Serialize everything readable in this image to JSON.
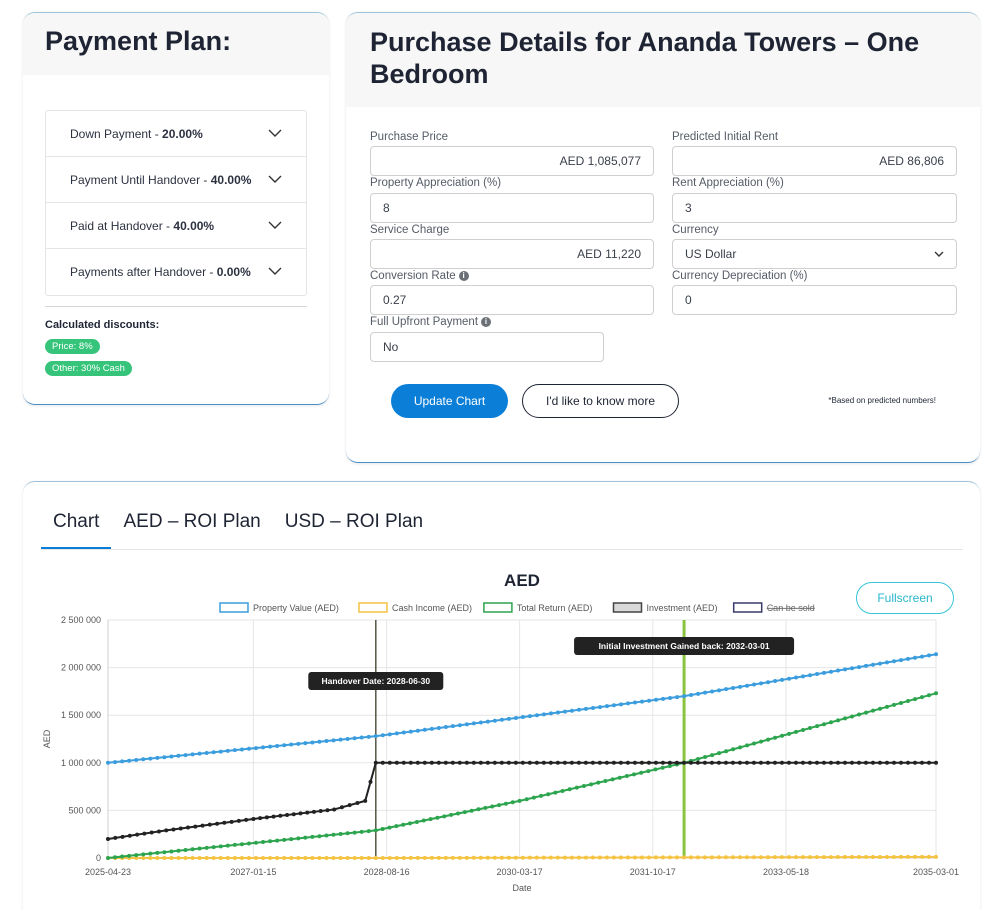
{
  "payment_plan": {
    "title": "Payment Plan:",
    "items": [
      {
        "label": "Down Payment - ",
        "value": "20.00%"
      },
      {
        "label": "Payment Until Handover - ",
        "value": "40.00%"
      },
      {
        "label": "Paid at Handover - ",
        "value": "40.00%"
      },
      {
        "label": "Payments after Handover - ",
        "value": "0.00%"
      }
    ],
    "discounts_label": "Calculated discounts:",
    "badges": [
      "Price: 8%",
      "Other: 30% Cash"
    ]
  },
  "purchase": {
    "title": "Purchase Details for Ananda Towers – One Bedroom",
    "fields": {
      "purchase_price": {
        "label": "Purchase Price",
        "value": "AED 1,085,077"
      },
      "initial_rent": {
        "label": "Predicted Initial Rent",
        "value": "AED 86,806"
      },
      "property_appreciation": {
        "label": "Property Appreciation (%)",
        "value": "8"
      },
      "rent_appreciation": {
        "label": "Rent Appreciation (%)",
        "value": "3"
      },
      "service_charge": {
        "label": "Service Charge",
        "value": "AED 11,220"
      },
      "currency": {
        "label": "Currency",
        "value": "US Dollar"
      },
      "conversion_rate": {
        "label": "Conversion Rate",
        "value": "0.27"
      },
      "currency_depreciation": {
        "label": "Currency Depreciation (%)",
        "value": "0"
      },
      "full_upfront": {
        "label": "Full Upfront Payment",
        "value": "No"
      }
    },
    "update_button": "Update Chart",
    "more_button": "I'd like to know more",
    "note": "*Based on predicted numbers!"
  },
  "chart_section": {
    "tabs": [
      "Chart",
      "AED – ROI Plan",
      "USD – ROI Plan"
    ],
    "active_tab": 0,
    "fullscreen_label": "Fullscreen"
  },
  "chart_data": {
    "type": "line",
    "title": "AED",
    "xlabel": "Date",
    "ylabel": "AED",
    "ylim": [
      0,
      2500000
    ],
    "y_ticks": [
      "0",
      "500 000",
      "1 000 000",
      "1 500 000",
      "2 000 000",
      "2 500 000"
    ],
    "y_tick_values": [
      0,
      500000,
      1000000,
      1500000,
      2000000,
      2500000
    ],
    "x_ticks": [
      "2025-04-23",
      "2027-01-15",
      "2028-08-16",
      "2030-03-17",
      "2031-10-17",
      "2033-05-18",
      "2035-03-01"
    ],
    "x_range": [
      "2025-04-23",
      "2035-03-01"
    ],
    "grid": true,
    "legend_position": "top",
    "legend": [
      {
        "name": "Property Value (AED)",
        "stroke": "#3b9ddd",
        "fill": "#ffffff"
      },
      {
        "name": "Cash Income (AED)",
        "stroke": "#f5c342",
        "fill": "#ffffff"
      },
      {
        "name": "Total Return (AED)",
        "stroke": "#2da44e",
        "fill": "#ffffff"
      },
      {
        "name": "Investment (AED)",
        "stroke": "#444444",
        "fill": "#d9d9d9"
      },
      {
        "name": "Can be sold",
        "stroke": "#3a3a6a",
        "fill": "#ffffff",
        "hidden": true
      }
    ],
    "series": [
      {
        "name": "Property Value (AED)",
        "color": "#3b9ddd",
        "x": [
          "2025-04-23",
          "2028-06-30",
          "2032-03-01",
          "2035-03-01"
        ],
        "y": [
          1000000,
          1280000,
          1700000,
          2140000
        ]
      },
      {
        "name": "Cash Income (AED)",
        "color": "#f5c342",
        "x": [
          "2025-04-23",
          "2028-06-30",
          "2035-03-01"
        ],
        "y": [
          0,
          0,
          12000
        ]
      },
      {
        "name": "Total Return (AED)",
        "color": "#2da44e",
        "x": [
          "2025-04-23",
          "2028-06-30",
          "2030-03-17",
          "2032-03-01",
          "2035-03-01"
        ],
        "y": [
          0,
          290000,
          600000,
          1000000,
          1730000
        ]
      },
      {
        "name": "Investment (AED)",
        "color": "#222222",
        "x": [
          "2025-04-23",
          "2026-01-01",
          "2027-01-15",
          "2028-01-01",
          "2028-05-15",
          "2028-06-30",
          "2035-03-01"
        ],
        "y": [
          200000,
          290000,
          410000,
          510000,
          600000,
          1000000,
          1000000
        ]
      }
    ],
    "annotations": [
      {
        "type": "vline",
        "x": "2028-06-30",
        "color": "#555544",
        "label": "Handover Date: 2028-06-30"
      },
      {
        "type": "vline",
        "x": "2032-03-01",
        "color": "#8ac43f",
        "label": "Initial Investment Gained back: 2032-03-01"
      }
    ]
  }
}
